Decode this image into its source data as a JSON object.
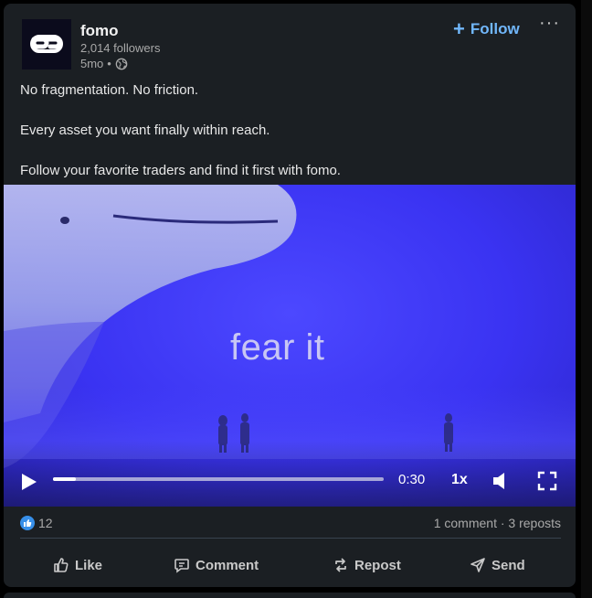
{
  "post": {
    "author": "fomo",
    "followers": "2,014 followers",
    "age": "5mo",
    "separator": "•",
    "follow_label": "Follow",
    "more_label": "···",
    "text": {
      "line1": "No fragmentation. No friction.",
      "line2": "Every asset you want finally within reach.",
      "line3": "Follow your favorite traders and find it first with fomo."
    }
  },
  "video": {
    "overlay_text": "fear it",
    "time": "0:30",
    "speed": "1x",
    "progress": 0.07,
    "bg_color": "#3b2ef0"
  },
  "stats": {
    "reactions": "12",
    "comments_reposts": "1 comment · 3 reposts"
  },
  "actions": {
    "like": "Like",
    "comment": "Comment",
    "repost": "Repost",
    "send": "Send"
  },
  "colors": {
    "accent": "#71b7fb",
    "card": "#1b1f23",
    "like_blue": "#378fe9"
  }
}
